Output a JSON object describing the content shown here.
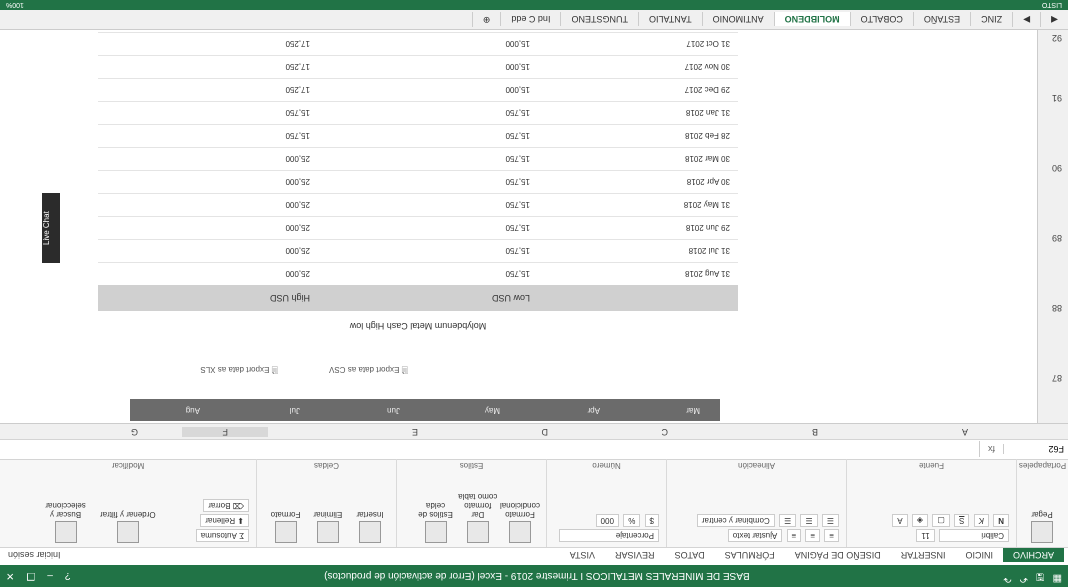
{
  "window": {
    "title": "BASE DE MINERALES METALICOS I Trimestre 2019 - Excel (Error de activación de productos)",
    "signin": "Iniciar sesión"
  },
  "ribbon_tabs": [
    "ARCHIVO",
    "INICIO",
    "INSERTAR",
    "DISEÑO DE PÁGINA",
    "FÓRMULAS",
    "DATOS",
    "REVISAR",
    "VISTA"
  ],
  "ribbon": {
    "clipboard": {
      "paste": "Pegar",
      "name": "Portapapeles"
    },
    "font": {
      "family": "Calibri",
      "size": "11",
      "name": "Fuente"
    },
    "alignment": {
      "wrap": "Ajustar texto",
      "merge": "Combinar y centrar",
      "name": "Alineación"
    },
    "number": {
      "format": "Porcentaje",
      "name": "Número"
    },
    "styles": {
      "conditional": "Formato condicional",
      "table": "Dar formato como tabla",
      "cell": "Estilos de celda",
      "name": "Estilos"
    },
    "cells": {
      "insert": "Insertar",
      "delete": "Eliminar",
      "format": "Formato",
      "name": "Celdas"
    },
    "editing": {
      "autosum": "Autosuma",
      "fill": "Rellenar",
      "clear": "Borrar",
      "sort": "Ordenar y filtrar",
      "find": "Buscar y seleccionar",
      "name": "Modificar"
    }
  },
  "formula_bar": {
    "name_box": "F62",
    "fx": "fx"
  },
  "columns": [
    "A",
    "B",
    "C",
    "D",
    "E",
    "F",
    "G"
  ],
  "rows": [
    "87",
    "88",
    "89",
    "90",
    "91",
    "92"
  ],
  "web": {
    "months": [
      "Mar",
      "Apr",
      "May",
      "Jun",
      "Jul",
      "Aug"
    ],
    "export_csv": "Export data as CSV",
    "export_xls": "Export data as XLS",
    "table_caption": "Molybdenum Metal Cash High low",
    "headers": [
      "",
      "Low USD",
      "High USD"
    ],
    "rows": [
      [
        "31 Aug 2018",
        "15,750",
        "25,000"
      ],
      [
        "31 Jul 2018",
        "15,750",
        "25,000"
      ],
      [
        "29 Jun 2018",
        "15,750",
        "25,000"
      ],
      [
        "31 May 2018",
        "15,750",
        "25,000"
      ],
      [
        "30 Apr 2018",
        "15,750",
        "25,000"
      ],
      [
        "30 Mar 2018",
        "15,750",
        "25,000"
      ],
      [
        "28 Feb 2018",
        "15,750",
        "15,750"
      ],
      [
        "31 Jan 2018",
        "15,750",
        "15,750"
      ],
      [
        "29 Dec 2017",
        "15,000",
        "17,250"
      ],
      [
        "30 Nov 2017",
        "15,000",
        "17,250"
      ],
      [
        "31 Oct 2017",
        "15,000",
        "17,250"
      ]
    ],
    "live_chat": "Live Chat"
  },
  "sheet_tabs": [
    "ZINC",
    "ESTAÑO",
    "COBALTO",
    "MOLIBDENO",
    "ANTIMONIO",
    "TANTALIO",
    "TUNGSTENO",
    "Ind C edd"
  ],
  "status": {
    "zoom": "100%",
    "ready": "LISTO"
  },
  "taskbar": {
    "time": "9:25 p.m.",
    "date": "17/12/2018",
    "lang": "ESP"
  }
}
